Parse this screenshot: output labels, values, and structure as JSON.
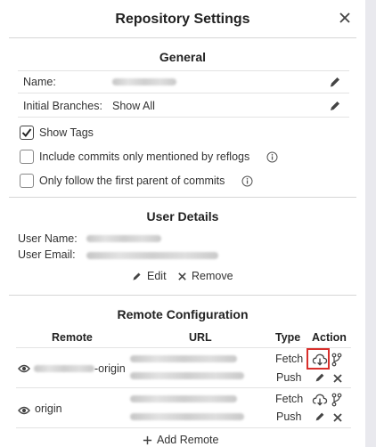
{
  "dialog": {
    "title": "Repository Settings",
    "close_icon": "close-icon"
  },
  "general": {
    "heading": "General",
    "name_label": "Name:",
    "name_value": "",
    "initial_branches_label": "Initial Branches:",
    "initial_branches_value": "Show All",
    "show_tags_label": "Show Tags",
    "show_tags_checked": true,
    "include_reflogs_label": "Include commits only mentioned by reflogs",
    "include_reflogs_checked": false,
    "first_parent_label": "Only follow the first parent of commits",
    "first_parent_checked": false
  },
  "user_details": {
    "heading": "User Details",
    "user_name_label": "User Name:",
    "user_email_label": "User Email:",
    "edit_label": "Edit",
    "remove_label": "Remove"
  },
  "remote_config": {
    "heading": "Remote Configuration",
    "columns": [
      "Remote",
      "URL",
      "Type",
      "Action"
    ],
    "remotes": [
      {
        "name_suffix": "-origin",
        "types": [
          "Fetch",
          "Push"
        ]
      },
      {
        "name": "origin",
        "types": [
          "Fetch",
          "Push"
        ]
      }
    ],
    "add_remote_label": "Add Remote",
    "highlight_color": "#d9302c"
  }
}
